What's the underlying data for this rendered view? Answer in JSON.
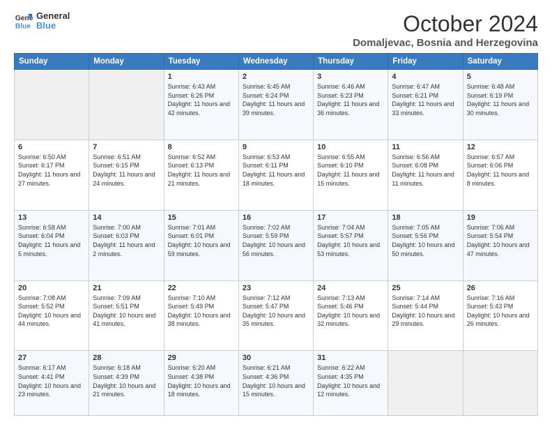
{
  "header": {
    "logo_line1": "General",
    "logo_line2": "Blue",
    "month": "October 2024",
    "location": "Domaljevac, Bosnia and Herzegovina"
  },
  "days_of_week": [
    "Sunday",
    "Monday",
    "Tuesday",
    "Wednesday",
    "Thursday",
    "Friday",
    "Saturday"
  ],
  "weeks": [
    [
      {
        "day": "",
        "info": ""
      },
      {
        "day": "",
        "info": ""
      },
      {
        "day": "1",
        "info": "Sunrise: 6:43 AM\nSunset: 6:26 PM\nDaylight: 11 hours and 42 minutes."
      },
      {
        "day": "2",
        "info": "Sunrise: 6:45 AM\nSunset: 6:24 PM\nDaylight: 11 hours and 39 minutes."
      },
      {
        "day": "3",
        "info": "Sunrise: 6:46 AM\nSunset: 6:23 PM\nDaylight: 11 hours and 36 minutes."
      },
      {
        "day": "4",
        "info": "Sunrise: 6:47 AM\nSunset: 6:21 PM\nDaylight: 11 hours and 33 minutes."
      },
      {
        "day": "5",
        "info": "Sunrise: 6:48 AM\nSunset: 6:19 PM\nDaylight: 11 hours and 30 minutes."
      }
    ],
    [
      {
        "day": "6",
        "info": "Sunrise: 6:50 AM\nSunset: 6:17 PM\nDaylight: 11 hours and 27 minutes."
      },
      {
        "day": "7",
        "info": "Sunrise: 6:51 AM\nSunset: 6:15 PM\nDaylight: 11 hours and 24 minutes."
      },
      {
        "day": "8",
        "info": "Sunrise: 6:52 AM\nSunset: 6:13 PM\nDaylight: 11 hours and 21 minutes."
      },
      {
        "day": "9",
        "info": "Sunrise: 6:53 AM\nSunset: 6:11 PM\nDaylight: 11 hours and 18 minutes."
      },
      {
        "day": "10",
        "info": "Sunrise: 6:55 AM\nSunset: 6:10 PM\nDaylight: 11 hours and 15 minutes."
      },
      {
        "day": "11",
        "info": "Sunrise: 6:56 AM\nSunset: 6:08 PM\nDaylight: 11 hours and 11 minutes."
      },
      {
        "day": "12",
        "info": "Sunrise: 6:57 AM\nSunset: 6:06 PM\nDaylight: 11 hours and 8 minutes."
      }
    ],
    [
      {
        "day": "13",
        "info": "Sunrise: 6:58 AM\nSunset: 6:04 PM\nDaylight: 11 hours and 5 minutes."
      },
      {
        "day": "14",
        "info": "Sunrise: 7:00 AM\nSunset: 6:03 PM\nDaylight: 11 hours and 2 minutes."
      },
      {
        "day": "15",
        "info": "Sunrise: 7:01 AM\nSunset: 6:01 PM\nDaylight: 10 hours and 59 minutes."
      },
      {
        "day": "16",
        "info": "Sunrise: 7:02 AM\nSunset: 5:59 PM\nDaylight: 10 hours and 56 minutes."
      },
      {
        "day": "17",
        "info": "Sunrise: 7:04 AM\nSunset: 5:57 PM\nDaylight: 10 hours and 53 minutes."
      },
      {
        "day": "18",
        "info": "Sunrise: 7:05 AM\nSunset: 5:56 PM\nDaylight: 10 hours and 50 minutes."
      },
      {
        "day": "19",
        "info": "Sunrise: 7:06 AM\nSunset: 5:54 PM\nDaylight: 10 hours and 47 minutes."
      }
    ],
    [
      {
        "day": "20",
        "info": "Sunrise: 7:08 AM\nSunset: 5:52 PM\nDaylight: 10 hours and 44 minutes."
      },
      {
        "day": "21",
        "info": "Sunrise: 7:09 AM\nSunset: 5:51 PM\nDaylight: 10 hours and 41 minutes."
      },
      {
        "day": "22",
        "info": "Sunrise: 7:10 AM\nSunset: 5:49 PM\nDaylight: 10 hours and 38 minutes."
      },
      {
        "day": "23",
        "info": "Sunrise: 7:12 AM\nSunset: 5:47 PM\nDaylight: 10 hours and 35 minutes."
      },
      {
        "day": "24",
        "info": "Sunrise: 7:13 AM\nSunset: 5:46 PM\nDaylight: 10 hours and 32 minutes."
      },
      {
        "day": "25",
        "info": "Sunrise: 7:14 AM\nSunset: 5:44 PM\nDaylight: 10 hours and 29 minutes."
      },
      {
        "day": "26",
        "info": "Sunrise: 7:16 AM\nSunset: 5:43 PM\nDaylight: 10 hours and 26 minutes."
      }
    ],
    [
      {
        "day": "27",
        "info": "Sunrise: 6:17 AM\nSunset: 4:41 PM\nDaylight: 10 hours and 23 minutes."
      },
      {
        "day": "28",
        "info": "Sunrise: 6:18 AM\nSunset: 4:39 PM\nDaylight: 10 hours and 21 minutes."
      },
      {
        "day": "29",
        "info": "Sunrise: 6:20 AM\nSunset: 4:38 PM\nDaylight: 10 hours and 18 minutes."
      },
      {
        "day": "30",
        "info": "Sunrise: 6:21 AM\nSunset: 4:36 PM\nDaylight: 10 hours and 15 minutes."
      },
      {
        "day": "31",
        "info": "Sunrise: 6:22 AM\nSunset: 4:35 PM\nDaylight: 10 hours and 12 minutes."
      },
      {
        "day": "",
        "info": ""
      },
      {
        "day": "",
        "info": ""
      }
    ]
  ]
}
